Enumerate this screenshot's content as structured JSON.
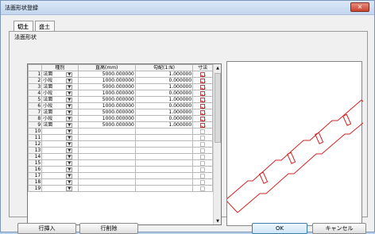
{
  "window": {
    "title": "法面形状登録",
    "close_symbol": "×"
  },
  "tabs": [
    {
      "label": "切土"
    },
    {
      "label": "盛土"
    }
  ],
  "section_label": "法面形状",
  "table": {
    "headers": [
      "",
      "種別",
      "直高(mm)",
      "勾配(1:N)",
      "寸法"
    ],
    "rows": [
      {
        "no": "1",
        "kind": "法面",
        "height": "5000.000000",
        "slope": "1.000000",
        "checked": true
      },
      {
        "no": "2",
        "kind": "小段",
        "height": "1000.000000",
        "slope": "0.000000",
        "checked": true
      },
      {
        "no": "3",
        "kind": "法面",
        "height": "5000.000000",
        "slope": "1.000000",
        "checked": true
      },
      {
        "no": "4",
        "kind": "小段",
        "height": "1000.000000",
        "slope": "0.000000",
        "checked": true
      },
      {
        "no": "5",
        "kind": "法面",
        "height": "5000.000000",
        "slope": "1.000000",
        "checked": true
      },
      {
        "no": "6",
        "kind": "小段",
        "height": "1000.000000",
        "slope": "0.000000",
        "checked": true
      },
      {
        "no": "7",
        "kind": "法面",
        "height": "5000.000000",
        "slope": "1.000000",
        "checked": true
      },
      {
        "no": "8",
        "kind": "小段",
        "height": "1000.000000",
        "slope": "0.000000",
        "checked": true
      },
      {
        "no": "9",
        "kind": "法面",
        "height": "5000.000000",
        "slope": "1.000000",
        "checked": true
      },
      {
        "no": "10",
        "kind": "",
        "height": "",
        "slope": "",
        "checked": false
      },
      {
        "no": "11",
        "kind": "",
        "height": "",
        "slope": "",
        "checked": false
      },
      {
        "no": "12",
        "kind": "",
        "height": "",
        "slope": "",
        "checked": false
      },
      {
        "no": "13",
        "kind": "",
        "height": "",
        "slope": "",
        "checked": false
      },
      {
        "no": "14",
        "kind": "",
        "height": "",
        "slope": "",
        "checked": false
      },
      {
        "no": "15",
        "kind": "",
        "height": "",
        "slope": "",
        "checked": false
      },
      {
        "no": "16",
        "kind": "",
        "height": "",
        "slope": "",
        "checked": false
      },
      {
        "no": "17",
        "kind": "",
        "height": "",
        "slope": "",
        "checked": false
      },
      {
        "no": "18",
        "kind": "",
        "height": "",
        "slope": "",
        "checked": false
      },
      {
        "no": "19",
        "kind": "",
        "height": "",
        "slope": "",
        "checked": false
      }
    ]
  },
  "buttons": {
    "insert_row": "行挿入",
    "delete_row": "行削除",
    "ok": "OK",
    "cancel": "キャンセル"
  },
  "icons": {
    "dropdown": "dropdown-arrow-icon",
    "checked": "checked-mark-icon",
    "close": "close-icon",
    "scroll_up": "scroll-up-icon",
    "scroll_down": "scroll-down-icon"
  },
  "colors": {
    "accent_red": "#d22323",
    "selection_border": "#3c7fb1"
  }
}
